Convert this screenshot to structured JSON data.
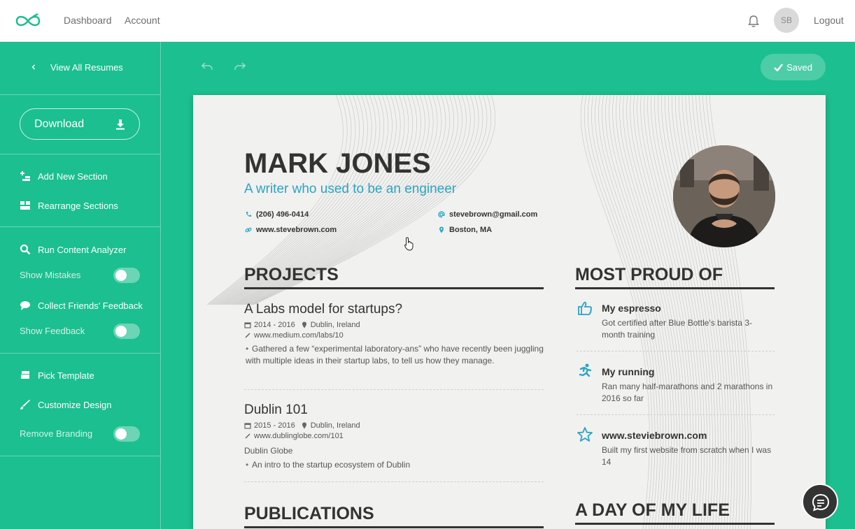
{
  "nav": {
    "dashboard": "Dashboard",
    "account": "Account",
    "avatar_initials": "SB",
    "logout": "Logout"
  },
  "sidebar": {
    "view_all": "View All Resumes",
    "download": "Download",
    "add_section": "Add New Section",
    "rearrange": "Rearrange Sections",
    "run_analyzer": "Run Content Analyzer",
    "show_mistakes": "Show Mistakes",
    "collect_feedback": "Collect Friends' Feedback",
    "show_feedback": "Show Feedback",
    "pick_template": "Pick Template",
    "customize_design": "Customize Design",
    "remove_branding": "Remove Branding"
  },
  "toolbar": {
    "saved": "Saved"
  },
  "resume": {
    "name": "MARK JONES",
    "tagline": "A writer who used to be an engineer",
    "phone": "(206) 496-0414",
    "email": "stevebrown@gmail.com",
    "website": "www.stevebrown.com",
    "location": "Boston, MA",
    "projects_title": "PROJECTS",
    "projects": [
      {
        "title": "A Labs model for startups?",
        "dates": "2014 - 2016",
        "place": "Dublin, Ireland",
        "link": "www.medium.com/labs/10",
        "bullet": "Gathered a few “experimental laboratory-ans” who have recently been juggling with multiple ideas in their startup labs, to tell us how they manage."
      },
      {
        "title": "Dublin 101",
        "dates": "2015 - 2016",
        "place": "Dublin, Ireland",
        "link": "www.dublinglobe.com/101",
        "org": "Dublin Globe",
        "bullet": "An intro to the startup ecosystem of Dublin"
      }
    ],
    "publications_title": "PUBLICATIONS",
    "proud_title": "MOST PROUD OF",
    "proud": [
      {
        "title": "My espresso",
        "desc": "Got certified after Blue Bottle's barista 3-month training",
        "icon": "thumbs-up-icon"
      },
      {
        "title": "My running",
        "desc": "Ran many half-marathons and 2 marathons in 2016 so far",
        "icon": "runner-icon"
      },
      {
        "title": "www.steviebrown.com",
        "desc": "Built my first website from scratch when I was 14",
        "icon": "star-icon"
      }
    ],
    "day_title": "A DAY OF MY LIFE"
  },
  "colors": {
    "accent": "#1cbf8f",
    "link_blue": "#2aa5c4"
  }
}
